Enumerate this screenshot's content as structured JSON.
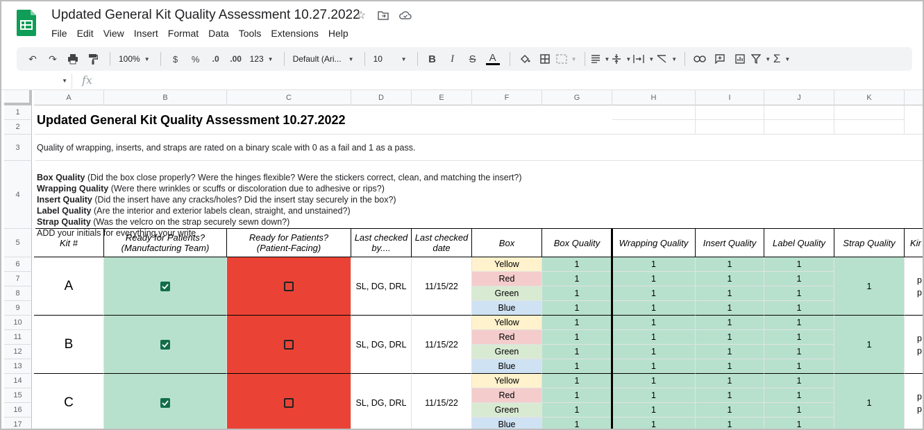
{
  "app": {
    "title": "Updated General Kit Quality Assessment 10.27.2022",
    "menu": [
      "File",
      "Edit",
      "View",
      "Insert",
      "Format",
      "Data",
      "Tools",
      "Extensions",
      "Help"
    ]
  },
  "toolbar": {
    "zoom": "100%",
    "currency": "$",
    "percent": "%",
    "dec_decrease": ".0",
    "dec_increase": ".00",
    "format_more": "123",
    "font": "Default (Ari...",
    "font_size": "10",
    "bold": "B",
    "italic": "I",
    "strike": "S",
    "text_color": "A"
  },
  "formula_bar": {
    "fx": "fx",
    "name_box": "",
    "value": ""
  },
  "columns": [
    "A",
    "B",
    "C",
    "D",
    "E",
    "F",
    "G",
    "H",
    "I",
    "J",
    "K"
  ],
  "rows": [
    "1",
    "2",
    "3",
    "4",
    "5",
    "6",
    "7",
    "8",
    "9",
    "10",
    "11",
    "12",
    "13",
    "14",
    "15",
    "16",
    "17"
  ],
  "sheet": {
    "title": "Updated General Kit Quality Assessment 10.27.2022",
    "row3": "Quality of wrapping, inserts, and straps are rated on a binary scale with 0 as a fail and 1 as a pass.",
    "criteria": [
      {
        "label": "Box Quality",
        "text": " (Did the box close properly? Were the hinges flexible? Were the stickers correct, clean, and matching the insert?)"
      },
      {
        "label": "Wrapping Quality",
        "text": " (Were there wrinkles or scuffs or discoloration due to adhesive or rips?)"
      },
      {
        "label": "Insert Quality",
        "text": " (Did the insert have any cracks/holes? Did the insert stay securely in the box?)"
      },
      {
        "label": "Label Quality",
        "text": " (Are the interior and exterior labels clean, straight, and unstained?)"
      },
      {
        "label": "Strap Quality",
        "text": " (Was the velcro on the strap securely sewn down?)"
      }
    ],
    "row4_last": "ADD your initials for everything your write",
    "headers": {
      "kit": "Kit #",
      "ready_mfg_1": "Ready for Patients?",
      "ready_mfg_2": "(Manufacturing Team)",
      "ready_pf_1": "Ready for Patients?",
      "ready_pf_2": "(Patient-Facing)",
      "checked_by_1": "Last checked",
      "checked_by_2": "by....",
      "checked_date_1": "Last checked",
      "checked_date_2": "date",
      "box": "Box",
      "box_quality": "Box Quality",
      "wrapping_quality": "Wrapping Quality",
      "insert_quality": "Insert Quality",
      "label_quality": "Label Quality",
      "strap_quality": "Strap Quality",
      "next": "Kir"
    },
    "kits": [
      {
        "kit": "A",
        "mfg_ready": true,
        "pf_ready": false,
        "checked_by": "SL, DG, DRL",
        "date": "11/15/22",
        "strap": "1",
        "overflow": [
          "p",
          "p"
        ]
      },
      {
        "kit": "B",
        "mfg_ready": true,
        "pf_ready": false,
        "checked_by": "SL, DG, DRL",
        "date": "11/15/22",
        "strap": "1",
        "overflow": [
          "p",
          "p"
        ]
      },
      {
        "kit": "C",
        "mfg_ready": true,
        "pf_ready": false,
        "checked_by": "SL, DG, DRL",
        "date": "11/15/22",
        "strap": "1",
        "overflow": [
          "p",
          "p"
        ]
      }
    ],
    "boxes": [
      "Yellow",
      "Red",
      "Green",
      "Blue"
    ],
    "score": "1"
  },
  "colors": {
    "pass_green": "#b7e1cd",
    "fail_red": "#ea4335",
    "yellow": "#fff2cc",
    "red_light": "#f4cccc",
    "green_light": "#d9ead3",
    "blue_light": "#cfe2f3",
    "checkbox_green": "#136d4b"
  }
}
